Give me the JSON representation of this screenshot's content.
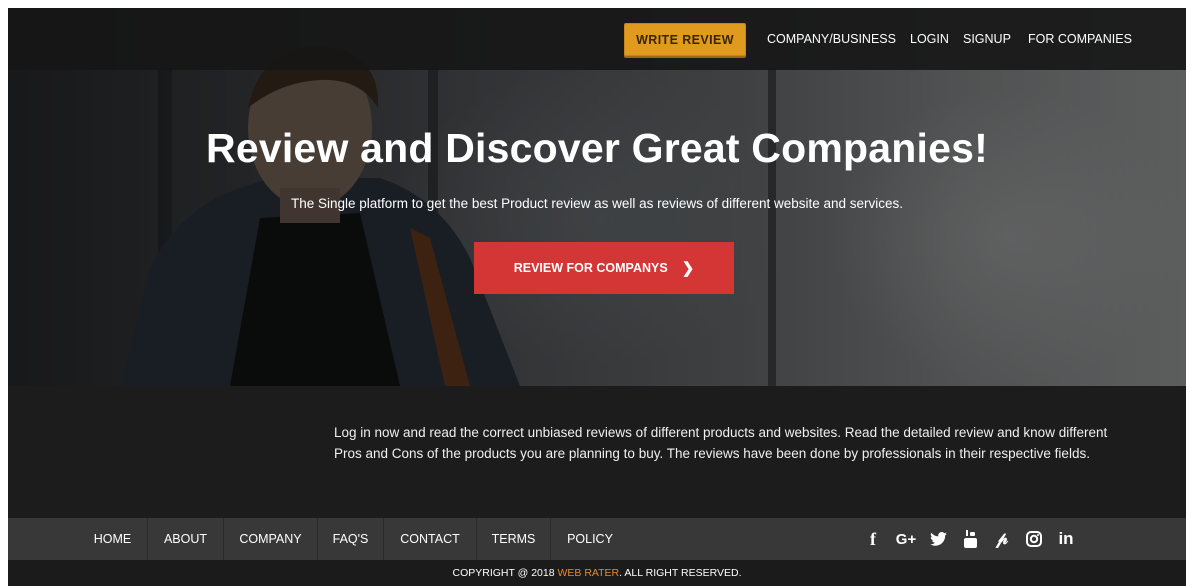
{
  "colors": {
    "accent_orange": "#e09a1d",
    "cta_red": "#d43535",
    "brand_orange": "#e8892a",
    "footer_bar": "#383838",
    "dark_bg": "#1c1c1c"
  },
  "nav": {
    "write_review": "WRITE REVIEW",
    "links": [
      "COMPANY/BUSINESS",
      "LOGIN",
      "SIGNUP",
      "FOR COMPANIES"
    ]
  },
  "hero": {
    "title": "Review and Discover Great Companies!",
    "subtitle": "The Single platform to get the best Product review as well as reviews of different website and services.",
    "cta_label": "REVIEW FOR COMPANYS",
    "cta_icon": "chevron-right-icon"
  },
  "description": "Log in now and read the correct unbiased reviews of different products and websites. Read the detailed review and know different Pros and Cons of the products you are planning to buy. The reviews have been done by professionals in their respective fields.",
  "footer": {
    "links": [
      "HOME",
      "ABOUT",
      "COMPANY",
      "FAQ'S",
      "CONTACT",
      "TERMS",
      "POLICY"
    ],
    "social": [
      "facebook-icon",
      "google-plus-icon",
      "twitter-icon",
      "youtube-icon",
      "pinterest-icon",
      "instagram-icon",
      "linkedin-icon"
    ],
    "copyright_prefix": "COPYRIGHT @ 2018 ",
    "copyright_brand": "WEB RATER",
    "copyright_suffix": ". ALL RIGHT RESERVED."
  }
}
